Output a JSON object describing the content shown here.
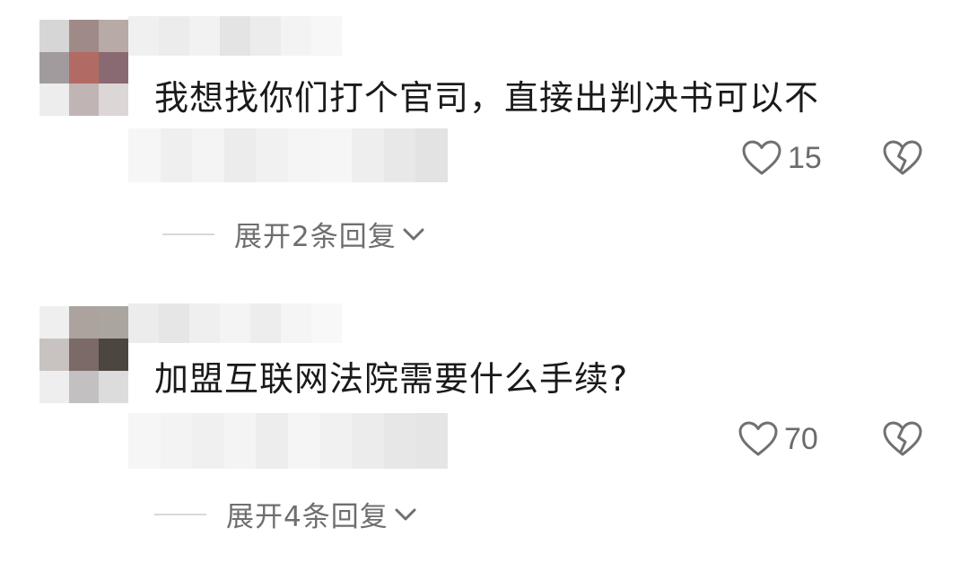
{
  "comments": [
    {
      "text": "我想找你们打个官司，直接出判决书可以不",
      "likes": "15",
      "replies_label": "展开2条回复",
      "avatar_colors": [
        "#d6d6d6",
        "#a08a87",
        "#b7aaa7",
        "#a29b9d",
        "#b26b64",
        "#8a6a72",
        "#eeeded",
        "#c0b4b4",
        "#ddd6d6"
      ],
      "name_colors": [
        "#f0f0f0",
        "#ececec",
        "#f2f2f2",
        "#e4e4e4",
        "#ececec",
        "#f3f3f3",
        "#f7f7f7"
      ],
      "meta_colors": [
        "#f6f6f6",
        "#efefef",
        "#f4f4f4",
        "#ececec",
        "#f1f1f1",
        "#f5f5f5",
        "#f6f6f6",
        "#eeeeee",
        "#e8e8e8",
        "#e3e3e3"
      ]
    },
    {
      "text": "加盟互联网法院需要什么手续?",
      "likes": "70",
      "replies_label": "展开4条回复",
      "avatar_colors": [
        "#efefef",
        "#aca39e",
        "#aaa59f",
        "#c8c2c0",
        "#7c6a66",
        "#4b463f",
        "#eeeeee",
        "#c2c0c0",
        "#dcdcdc"
      ],
      "name_colors": [
        "#ececec",
        "#e6e6e6",
        "#efefef",
        "#f4f4f4",
        "#ededed",
        "#f5f5f5",
        "#f8f8f8"
      ],
      "meta_colors": [
        "#f6f6f6",
        "#f3f3f3",
        "#f0f0f0",
        "#f4f4f4",
        "#ededed",
        "#f5f5f5",
        "#f1f1f1",
        "#ececec",
        "#e7e7e7",
        "#e5e5e5"
      ]
    }
  ],
  "icons": {
    "like": "heart-outline-icon",
    "dislike": "broken-heart-icon",
    "expand": "chevron-down-icon"
  },
  "colors": {
    "text": "#1a1a1a",
    "muted": "#6e6e6e",
    "icon": "#707070"
  }
}
